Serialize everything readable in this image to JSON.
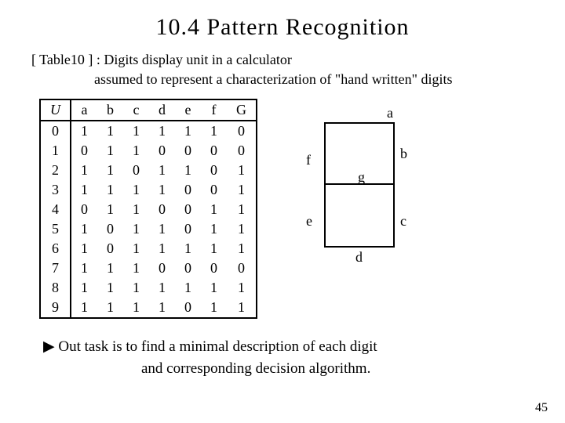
{
  "title": "10.4 Pattern Recognition",
  "caption_a": "[ Table10 ] : Digits display unit in a calculator",
  "caption_b": "assumed to represent a characterization of \"hand written\" digits",
  "chart_data": {
    "type": "table",
    "columns": [
      "U",
      "a",
      "b",
      "c",
      "d",
      "e",
      "f",
      "G"
    ],
    "rows": [
      [
        "0",
        "1",
        "1",
        "1",
        "1",
        "1",
        "1",
        "0"
      ],
      [
        "1",
        "0",
        "1",
        "1",
        "0",
        "0",
        "0",
        "0"
      ],
      [
        "2",
        "1",
        "1",
        "0",
        "1",
        "1",
        "0",
        "1"
      ],
      [
        "3",
        "1",
        "1",
        "1",
        "1",
        "0",
        "0",
        "1"
      ],
      [
        "4",
        "0",
        "1",
        "1",
        "0",
        "0",
        "1",
        "1"
      ],
      [
        "5",
        "1",
        "0",
        "1",
        "1",
        "0",
        "1",
        "1"
      ],
      [
        "6",
        "1",
        "0",
        "1",
        "1",
        "1",
        "1",
        "1"
      ],
      [
        "7",
        "1",
        "1",
        "1",
        "0",
        "0",
        "0",
        "0"
      ],
      [
        "8",
        "1",
        "1",
        "1",
        "1",
        "1",
        "1",
        "1"
      ],
      [
        "9",
        "1",
        "1",
        "1",
        "1",
        "0",
        "1",
        "1"
      ]
    ]
  },
  "segments": {
    "a": "a",
    "b": "b",
    "c": "c",
    "d": "d",
    "e": "e",
    "f": "f",
    "g": "g"
  },
  "task_prefix": "▶",
  "task_line1": "Out task  is to find a minimal description of each digit",
  "task_line2": "and corresponding decision algorithm.",
  "pagenum": "45"
}
